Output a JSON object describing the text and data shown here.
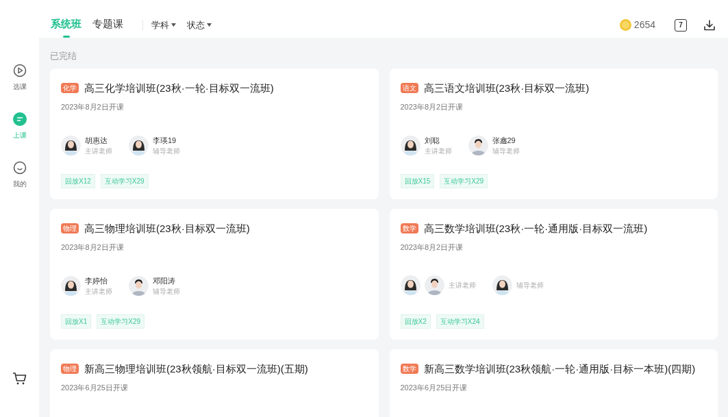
{
  "tabs": [
    {
      "label": "系统班",
      "selected": true
    },
    {
      "label": "专题课",
      "selected": false
    }
  ],
  "filters": [
    {
      "label": "学科"
    },
    {
      "label": "状态"
    }
  ],
  "header": {
    "coins": "2654",
    "calendar_day": "7"
  },
  "sidebar": {
    "items": [
      {
        "label": "选课",
        "kind": "play",
        "selected": false
      },
      {
        "label": "上课",
        "kind": "class",
        "selected": true
      },
      {
        "label": "我的",
        "kind": "smile",
        "selected": false
      }
    ]
  },
  "section_title": "已完结",
  "courses": [
    {
      "subject": "化学",
      "title": "高三化学培训班(23秋·一轮·目标双一流班)",
      "start": "2023年8月2日开课",
      "teachers": [
        {
          "avatars": [
            {
              "kind": "female"
            }
          ],
          "name": "胡惠达",
          "role": "主讲老师"
        },
        {
          "avatars": [
            {
              "kind": "female"
            }
          ],
          "name": "李瑛19",
          "role": "辅导老师"
        }
      ],
      "stats": [
        "回放X12",
        "互动学习X29"
      ]
    },
    {
      "subject": "语文",
      "title": "高三语文培训班(23秋·目标双一流班)",
      "start": "2023年8月2日开课",
      "teachers": [
        {
          "avatars": [
            {
              "kind": "female"
            }
          ],
          "name": "刘聪",
          "role": "主讲老师"
        },
        {
          "avatars": [
            {
              "kind": "male"
            }
          ],
          "name": "张鑫29",
          "role": "辅导老师"
        }
      ],
      "stats": [
        "回放X15",
        "互动学习X29"
      ]
    },
    {
      "subject": "物理",
      "title": "高三物理培训班(23秋·目标双一流班)",
      "start": "2023年8月2日开课",
      "teachers": [
        {
          "avatars": [
            {
              "kind": "female"
            }
          ],
          "name": "李婷怡",
          "role": "主讲老师"
        },
        {
          "avatars": [
            {
              "kind": "male"
            }
          ],
          "name": "邓阳涛",
          "role": "辅导老师"
        }
      ],
      "stats": [
        "回放X1",
        "互动学习X29"
      ]
    },
    {
      "subject": "数学",
      "title": "高三数学培训班(23秋·一轮·通用版·目标双一流班)",
      "start": "2023年8月2日开课",
      "teachers": [
        {
          "avatars": [
            {
              "kind": "female"
            },
            {
              "kind": "male"
            }
          ],
          "role": "主讲老师"
        },
        {
          "avatars": [
            {
              "kind": "female"
            }
          ],
          "role": "辅导老师"
        }
      ],
      "stats": [
        "回放X2",
        "互动学习X24"
      ]
    },
    {
      "subject": "物理",
      "title": "新高三物理培训班(23秋领航·目标双一流班)(五期)",
      "start": "2023年6月25日开课"
    },
    {
      "subject": "数学",
      "title": "新高三数学培训班(23秋领航·一轮·通用版·目标一本班)(四期)",
      "start": "2023年6月25日开课"
    }
  ]
}
